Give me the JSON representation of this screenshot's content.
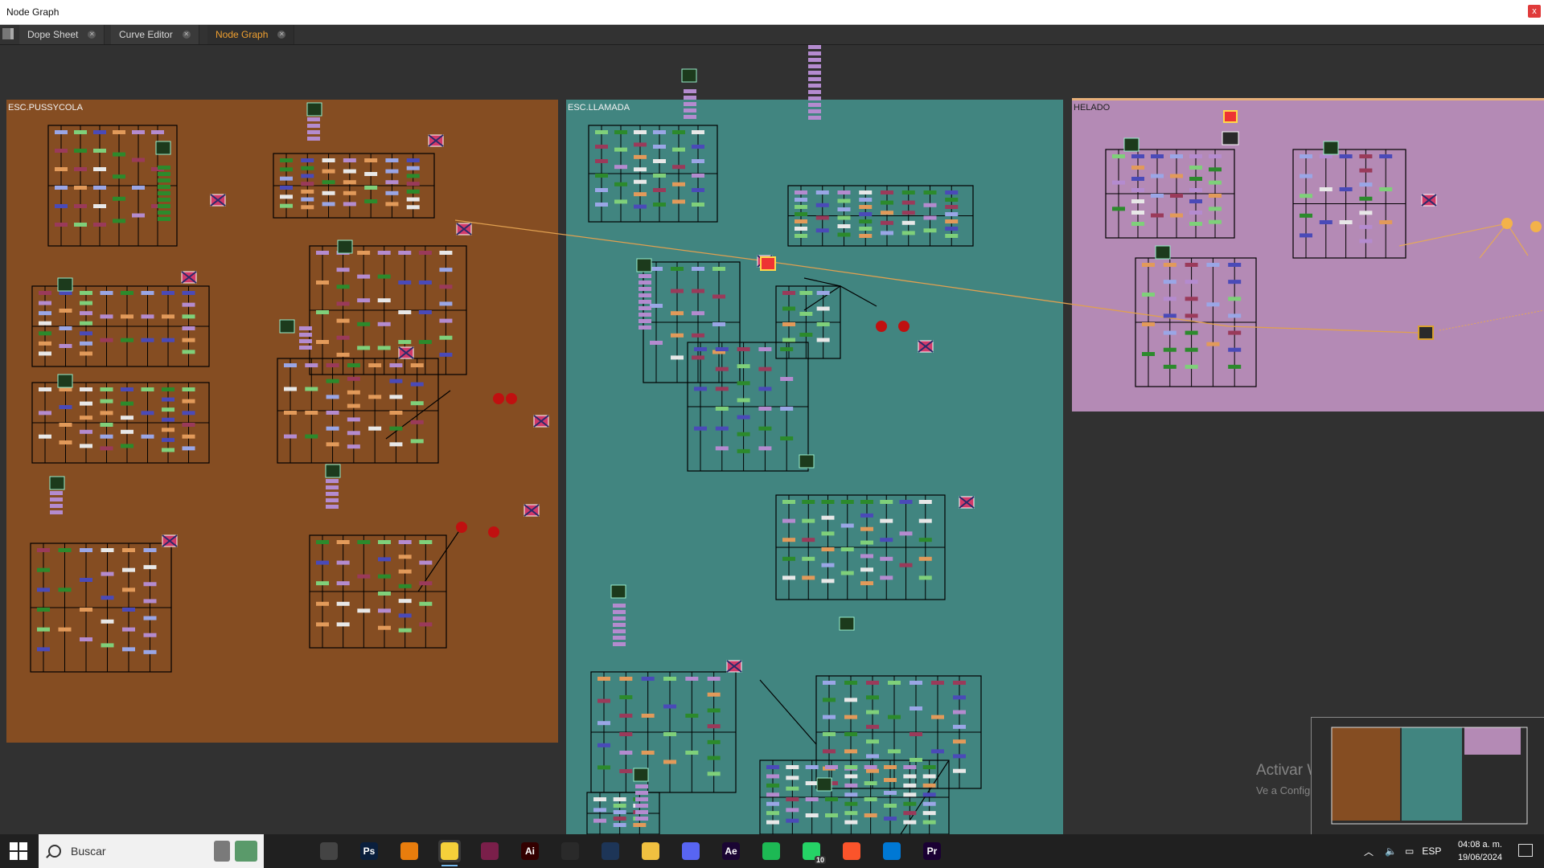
{
  "window": {
    "title": "Node Graph",
    "close_label": "x"
  },
  "tabs": [
    {
      "label": "Dope Sheet"
    },
    {
      "label": "Curve Editor"
    },
    {
      "label": "Node Graph"
    }
  ],
  "backdrops": [
    {
      "label": "ESC.PUSSYCOLA",
      "color": "#854d22"
    },
    {
      "label": "ESC.LLAMADA",
      "color": "#418580"
    },
    {
      "label": "HELADO",
      "color": "#b48ab5"
    }
  ],
  "node_colors": {
    "green": "#7fd07a",
    "purple": "#b48bcf",
    "orange": "#e29a5a",
    "blue": "#9aa6e6",
    "dark_green": "#2c8a2c",
    "dark_blue": "#4a4ab8",
    "maroon": "#9a3a5a",
    "white": "#e8e8e8",
    "red_dot": "#c01010",
    "wire": "#000000",
    "selected_wire": "#e0a050"
  },
  "watermark": {
    "line1": "Activar Windows",
    "line2": "Ve a Configuración para activar Windows."
  },
  "taskbar": {
    "search_placeholder": "Buscar",
    "apps": [
      {
        "name": "task-view-icon",
        "label": "",
        "color": "#202020"
      },
      {
        "name": "resolve-icon",
        "label": "",
        "color": "#444444"
      },
      {
        "name": "photoshop-icon",
        "label": "Ps",
        "color": "#0a1f3d"
      },
      {
        "name": "blender-icon",
        "label": "",
        "color": "#e87d0d"
      },
      {
        "name": "nuke-icon",
        "label": "",
        "color": "#f5d03a"
      },
      {
        "name": "app-check-icon",
        "label": "",
        "color": "#7a1f4a"
      },
      {
        "name": "illustrator-icon",
        "label": "Ai",
        "color": "#330000"
      },
      {
        "name": "davinci-icon",
        "label": "",
        "color": "#2a2a2a"
      },
      {
        "name": "cinema4d-icon",
        "label": "",
        "color": "#1d3557"
      },
      {
        "name": "file-explorer-icon",
        "label": "",
        "color": "#f0c040"
      },
      {
        "name": "discord-icon",
        "label": "",
        "color": "#5865f2"
      },
      {
        "name": "after-effects-icon",
        "label": "Ae",
        "color": "#1a0533"
      },
      {
        "name": "spotify-icon",
        "label": "",
        "color": "#1db954"
      },
      {
        "name": "whatsapp-icon",
        "label": "",
        "color": "#25d366"
      },
      {
        "name": "brave-icon",
        "label": "",
        "color": "#fb542b"
      },
      {
        "name": "vscode-icon",
        "label": "",
        "color": "#0078d4"
      },
      {
        "name": "premiere-icon",
        "label": "Pr",
        "color": "#1a0033"
      }
    ],
    "whatsapp_badge": "10",
    "language": "ESP",
    "time": "04:08 a. m.",
    "date": "19/06/2024"
  }
}
